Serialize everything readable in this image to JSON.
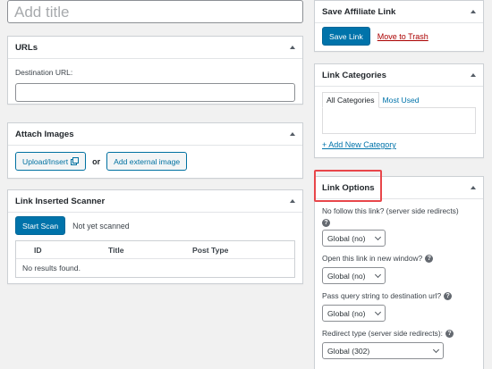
{
  "title_field": {
    "placeholder": "Add title"
  },
  "urls": {
    "heading": "URLs",
    "dest_label": "Destination URL:",
    "dest_value": ""
  },
  "attach": {
    "heading": "Attach Images",
    "upload_label": "Upload/Insert",
    "or_text": "or",
    "external_label": "Add external image"
  },
  "scanner": {
    "heading": "Link Inserted Scanner",
    "scan_button": "Start Scan",
    "status": "Not yet scanned",
    "columns": [
      "ID",
      "Title",
      "Post Type"
    ],
    "empty_text": "No results found."
  },
  "save": {
    "heading": "Save Affiliate Link",
    "save_button": "Save Link",
    "trash_link": "Move to Trash"
  },
  "categories": {
    "heading": "Link Categories",
    "tabs": [
      "All Categories",
      "Most Used"
    ],
    "add_link": "+ Add New Category"
  },
  "options": {
    "heading": "Link Options",
    "nofollow_label": "No follow this link? (server side redirects)",
    "nofollow_value": "Global (no)",
    "newwindow_label": "Open this link in new window?",
    "newwindow_value": "Global (no)",
    "query_label": "Pass query string to destination url?",
    "query_value": "Global (no)",
    "redirect_label": "Redirect type (server side redirects):",
    "redirect_value": "Global (302)"
  },
  "colors": {
    "primary": "#0073aa",
    "danger": "#a00000",
    "highlight": "#e8464a"
  },
  "icons": [
    "collapse-arrow-icon",
    "media-icon",
    "help-icon",
    "select-chevron-icon"
  ]
}
